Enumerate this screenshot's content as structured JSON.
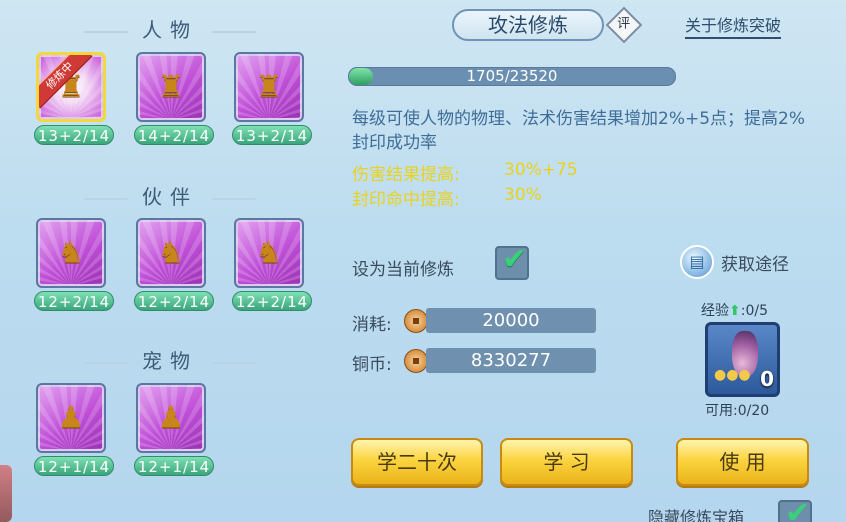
{
  "left": {
    "sections": [
      {
        "title": "人物",
        "cards": [
          {
            "level": "13+2/14",
            "active": true,
            "ribbon": "修炼中",
            "figure": "♜"
          },
          {
            "level": "14+2/14",
            "active": false,
            "figure": "♜"
          },
          {
            "level": "13+2/14",
            "active": false,
            "figure": "♜"
          }
        ]
      },
      {
        "title": "伙伴",
        "cards": [
          {
            "level": "12+2/14",
            "active": false,
            "figure": "♞"
          },
          {
            "level": "12+2/14",
            "active": false,
            "figure": "♞"
          },
          {
            "level": "12+2/14",
            "active": false,
            "figure": "♞"
          }
        ]
      },
      {
        "title": "宠物",
        "cards": [
          {
            "level": "12+1/14",
            "active": false,
            "figure": "♟"
          },
          {
            "level": "12+1/14",
            "active": false,
            "figure": "♟"
          }
        ]
      }
    ]
  },
  "right": {
    "tab_title": "攻法修炼",
    "eval_badge": "评",
    "breakthrough_link": "关于修炼突破",
    "exp": {
      "text": "1705/23520",
      "current": 1705,
      "max": 23520
    },
    "description": "每级可使人物的物理、法术伤害结果增加2%+5点；提高2%封印成功率",
    "stats": [
      {
        "label": "伤害结果提高:",
        "value": "30%+75"
      },
      {
        "label": "封印命中提高:",
        "value": "30%"
      }
    ],
    "set_current_label": "设为当前修炼",
    "set_current_checked": true,
    "obtain_label": "获取途径",
    "cost_label": "消耗:",
    "cost_value": "20000",
    "coins_label": "铜币:",
    "coins_value": "8330277",
    "exp_item_label": "经验",
    "exp_item_value": ":0/5",
    "item_count": "0",
    "usable_label": "可用:0/20",
    "buttons": {
      "learn20": "学二十次",
      "learn": "学 习",
      "use": "使 用"
    },
    "hide_label": "隐藏修炼宝箱"
  },
  "colors": {
    "accent_yellow": "#e9d21d",
    "level_green": "#3ba57c",
    "card_purple": "#c04fd8",
    "button_gold": "#fbd440"
  }
}
